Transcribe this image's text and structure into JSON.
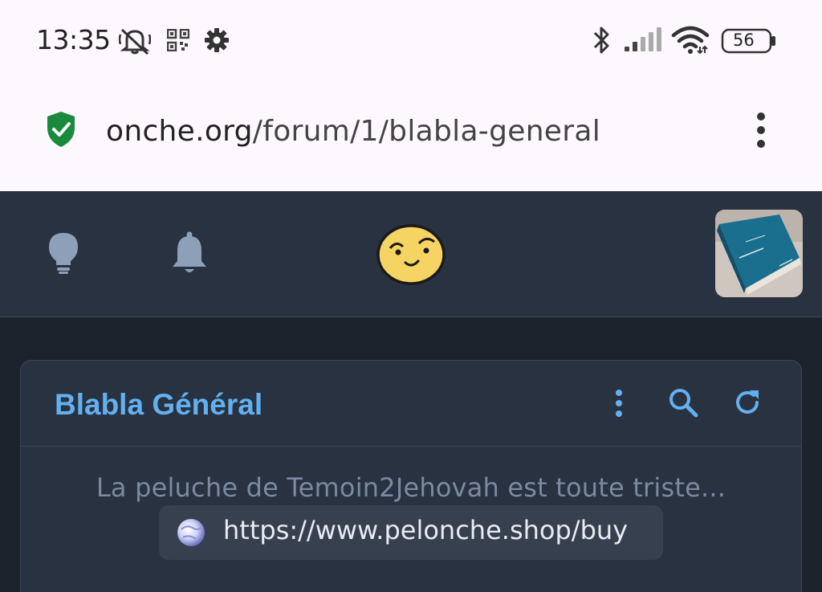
{
  "status_bar": {
    "time": "13:35",
    "battery": "56",
    "icons": [
      "muted-bell-icon",
      "qr-code-icon",
      "gear-icon",
      "bluetooth-icon",
      "signal-icon",
      "wifi-icon",
      "battery-icon"
    ]
  },
  "browser": {
    "url_domain": "onche.org",
    "url_path": "/forum/1/blabla-general",
    "security_icon": "shield-check-icon",
    "menu_icon": "kebab-menu-icon"
  },
  "site_header": {
    "icons": [
      "lightbulb-icon",
      "bell-icon",
      "smiley-logo",
      "user-avatar"
    ]
  },
  "forum": {
    "title": "Blabla Général",
    "actions": [
      "kebab-menu-icon",
      "search-icon",
      "refresh-icon"
    ],
    "notice_text": "La peluche de Temoin2Jehovah est toute triste...",
    "link_text": "https://www.pelonche.shop/buy"
  },
  "colors": {
    "accent": "#63b0f0",
    "header_bg": "#283241",
    "page_bg": "#1d232d",
    "secure_green": "#1a8a3c"
  }
}
